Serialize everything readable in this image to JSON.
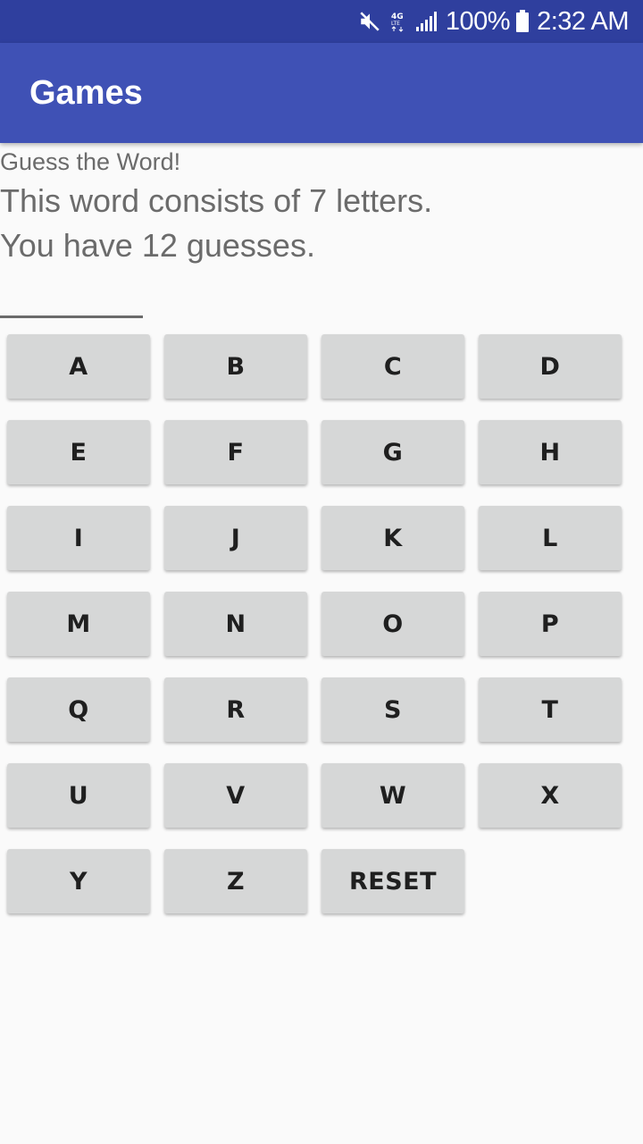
{
  "status_bar": {
    "icons": [
      "mute-icon",
      "lte-4g-icon",
      "signal-icon",
      "battery-icon"
    ],
    "battery_text": "100%",
    "time": "2:32 AM"
  },
  "app_bar": {
    "title": "Games",
    "color": "#3f51b5"
  },
  "game": {
    "subtitle": "Guess the Word!",
    "letters_info": "This word consists of 7 letters.",
    "guesses_info": "You have 12 guesses."
  },
  "keys": {
    "a": "A",
    "b": "B",
    "c": "C",
    "d": "D",
    "e": "E",
    "f": "F",
    "g": "G",
    "h": "H",
    "i": "I",
    "j": "J",
    "k": "K",
    "l": "L",
    "m": "M",
    "n": "N",
    "o": "O",
    "p": "P",
    "q": "Q",
    "r": "R",
    "s": "S",
    "t": "T",
    "u": "U",
    "v": "V",
    "w": "W",
    "x": "X",
    "y": "Y",
    "z": "Z",
    "reset": "RESET"
  }
}
